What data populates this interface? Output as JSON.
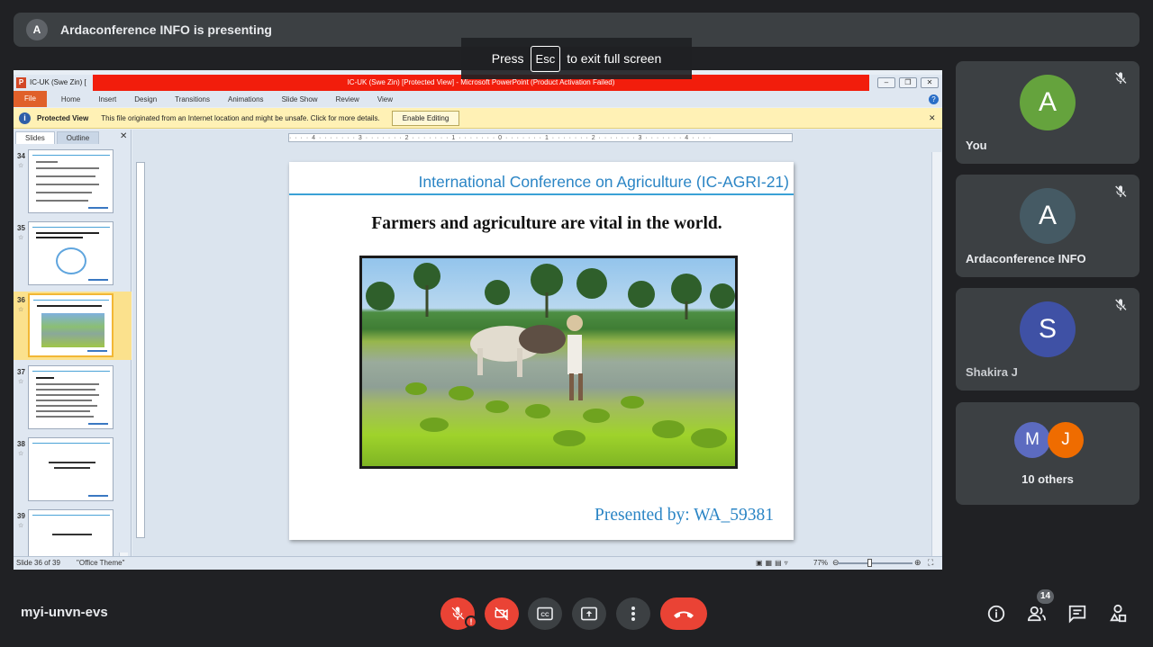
{
  "presenter_bar": {
    "avatar_initial": "A",
    "text": "Ardaconference INFO is presenting"
  },
  "fullscreen_toast": {
    "prefix": "Press",
    "key": "Esc",
    "suffix": "to exit full screen"
  },
  "powerpoint": {
    "doc_tab": "IC-UK (Swe Zin) [",
    "title": "IC-UK (Swe Zin) [Protected View] - Microsoft PowerPoint (Product Activation Failed)",
    "ribbon_tabs": [
      "File",
      "Home",
      "Insert",
      "Design",
      "Transitions",
      "Animations",
      "Slide Show",
      "Review",
      "View"
    ],
    "protected_view": {
      "label": "Protected View",
      "message": "This file originated from an Internet location and might be unsafe. Click for more details.",
      "button": "Enable Editing"
    },
    "panel_tabs": [
      "Slides",
      "Outline"
    ],
    "thumbnails": [
      {
        "number": "34",
        "selected": false
      },
      {
        "number": "35",
        "selected": false
      },
      {
        "number": "36",
        "selected": true
      },
      {
        "number": "37",
        "selected": false
      },
      {
        "number": "38",
        "selected": false
      },
      {
        "number": "39",
        "selected": false
      }
    ],
    "ruler_text": "· · · · 4 · · · · · · · 3 · · · · · · · 2 · · · · · · · 1 · · · · · · · 0 · · · · · · · 1 · · · · · · · 2 · · · · · · · 3 · · · · · · · 4 · · · ·",
    "slide": {
      "header": "International Conference on Agriculture (IC-AGRI-21)",
      "title": "Farmers and agriculture are vital in the world.",
      "footer": "Presented by:   WA_59381"
    },
    "status": {
      "slide": "Slide 36 of 39",
      "theme": "\"Office Theme\"",
      "zoom": "77%"
    }
  },
  "participants": [
    {
      "name": "You",
      "initial": "A",
      "color": "#65a33d"
    },
    {
      "name": "Ardaconference INFO",
      "initial": "A",
      "color": "#455a64"
    },
    {
      "name": "Shakira J",
      "initial": "S",
      "color": "#3f51a5"
    }
  ],
  "others": {
    "label": "10 others",
    "initials": [
      "M",
      "J"
    ],
    "colors": [
      "#5c6bc0",
      "#ef6c00"
    ]
  },
  "bottom_bar": {
    "meeting_code": "myi-unvn-evs",
    "people_count": "14",
    "alert": "!"
  }
}
